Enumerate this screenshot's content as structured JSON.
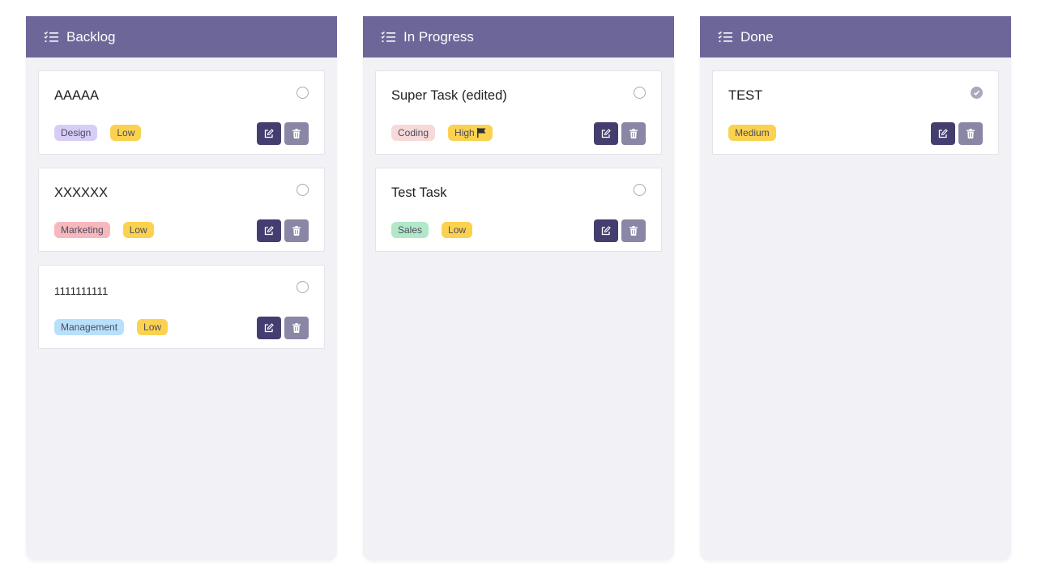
{
  "colors": {
    "header": "#6d6699",
    "column_bg": "#f1f1f6",
    "edit_button": "#443e70",
    "delete_button": "#8a86a6"
  },
  "columns": [
    {
      "title": "Backlog",
      "tasks": [
        {
          "title": "AAAAA",
          "done": false,
          "tags": [
            {
              "label": "Design",
              "color": "#d8cdf6"
            },
            {
              "label": "Low",
              "color": "#fbd250"
            }
          ]
        },
        {
          "title": "XXXXXX",
          "done": false,
          "tags": [
            {
              "label": "Marketing",
              "color": "#f7b8bd"
            },
            {
              "label": "Low",
              "color": "#fbd250"
            }
          ]
        },
        {
          "title": "1111111111",
          "done": false,
          "tags": [
            {
              "label": "Management",
              "color": "#b8e0fb"
            },
            {
              "label": "Low",
              "color": "#fbd250"
            }
          ]
        }
      ]
    },
    {
      "title": "In Progress",
      "tasks": [
        {
          "title": "Super Task (edited)",
          "done": false,
          "tags": [
            {
              "label": "Coding",
              "color": "#f7d9d9"
            },
            {
              "label": "High",
              "color": "#fbd250",
              "flag": true
            }
          ]
        },
        {
          "title": "Test Task",
          "done": false,
          "tags": [
            {
              "label": "Sales",
              "color": "#b1e8c8"
            },
            {
              "label": "Low",
              "color": "#fbd250"
            }
          ]
        }
      ]
    },
    {
      "title": "Done",
      "tasks": [
        {
          "title": "TEST",
          "done": true,
          "tags": [
            {
              "label": "Medium",
              "color": "#fbd250"
            }
          ]
        }
      ]
    }
  ]
}
